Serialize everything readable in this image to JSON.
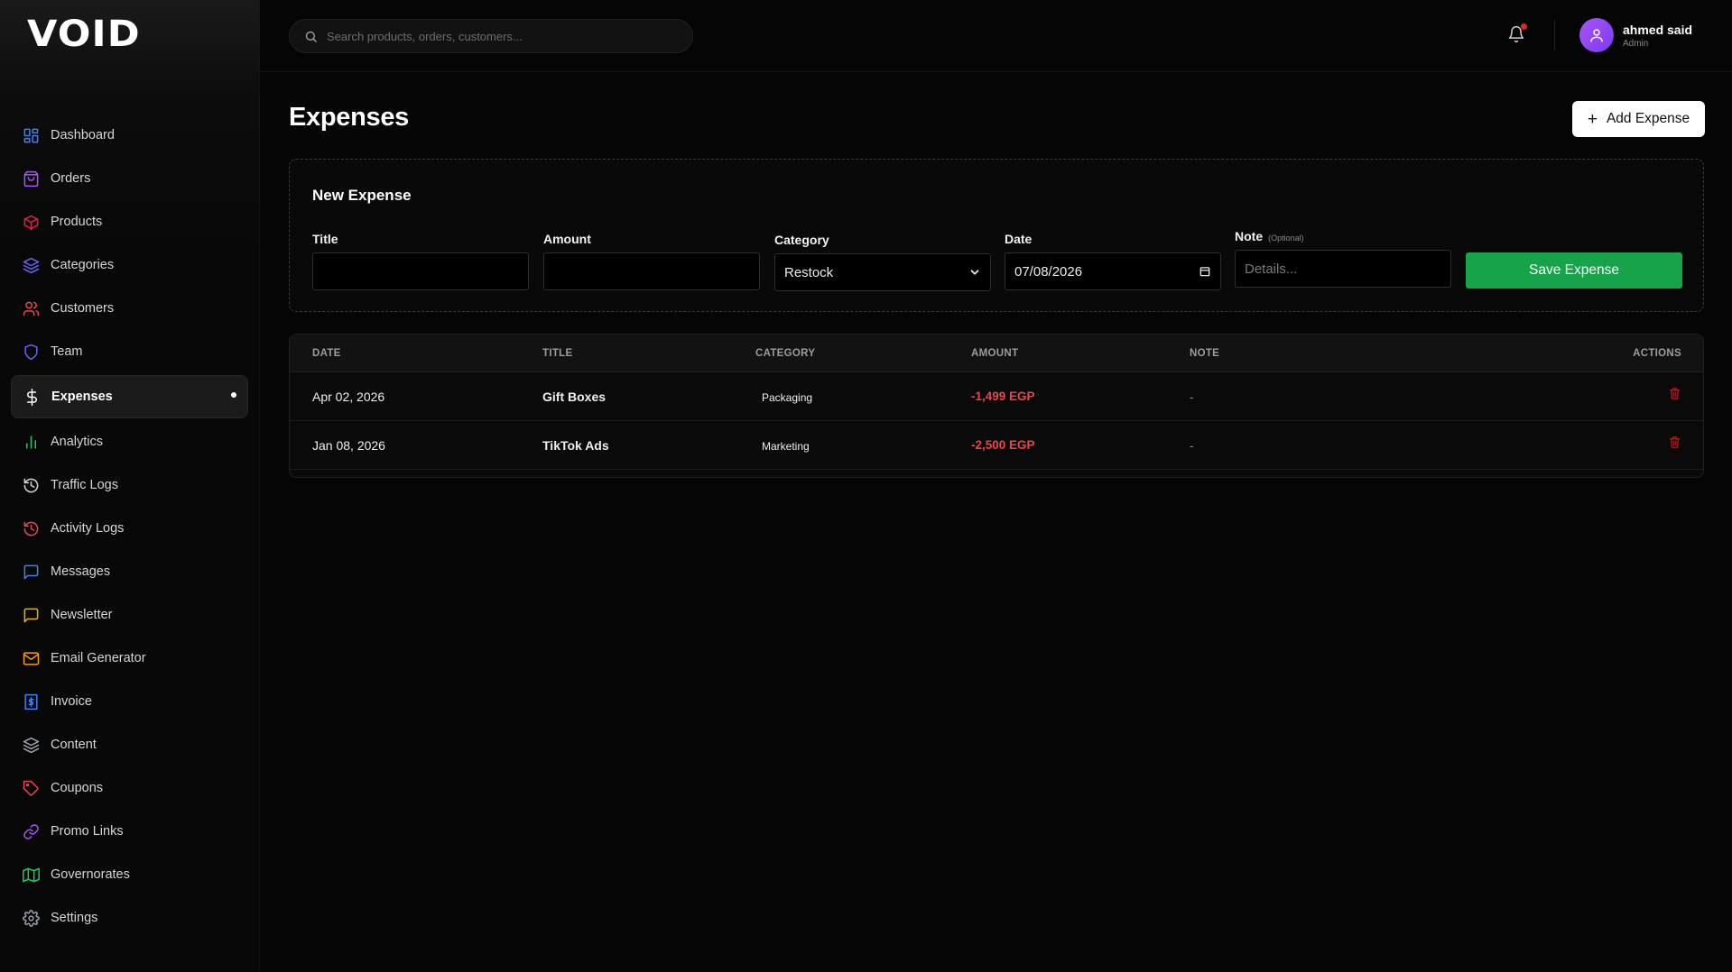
{
  "app": {
    "logo_text": "VOID"
  },
  "sidebar": {
    "items": [
      {
        "label": "Dashboard",
        "icon": "dashboard-icon",
        "color": "#3b82f6"
      },
      {
        "label": "Orders",
        "icon": "shopping-bag-icon",
        "color": "#a855f7"
      },
      {
        "label": "Products",
        "icon": "package-icon",
        "color": "#e11d48"
      },
      {
        "label": "Categories",
        "icon": "layers-icon",
        "color": "#6366f1"
      },
      {
        "label": "Customers",
        "icon": "users-icon",
        "color": "#ef4444"
      },
      {
        "label": "Team",
        "icon": "shield-icon",
        "color": "#6366f1"
      },
      {
        "label": "Expenses",
        "icon": "dollar-icon",
        "color": "#ffffff",
        "active": true
      },
      {
        "label": "Analytics",
        "icon": "bar-chart-icon",
        "color": "#22c55e"
      },
      {
        "label": "Traffic Logs",
        "icon": "history-icon",
        "color": "#d1d5db"
      },
      {
        "label": "Activity Logs",
        "icon": "history-icon",
        "color": "#ef4444"
      },
      {
        "label": "Messages",
        "icon": "message-icon",
        "color": "#3b82f6"
      },
      {
        "label": "Newsletter",
        "icon": "message-square-icon",
        "color": "#eab308"
      },
      {
        "label": "Email Generator",
        "icon": "mail-icon",
        "color": "#f59e0b"
      },
      {
        "label": "Invoice",
        "icon": "invoice-icon",
        "color": "#3b82f6"
      },
      {
        "label": "Content",
        "icon": "layers-icon",
        "color": "#9ca3af"
      },
      {
        "label": "Coupons",
        "icon": "tag-icon",
        "color": "#ef4444"
      },
      {
        "label": "Promo Links",
        "icon": "link-icon",
        "color": "#a855f7"
      },
      {
        "label": "Governorates",
        "icon": "map-icon",
        "color": "#22c55e"
      },
      {
        "label": "Settings",
        "icon": "gear-icon",
        "color": "#9ca3af"
      }
    ]
  },
  "topbar": {
    "search_placeholder": "Search products, orders, customers...",
    "user": {
      "name": "ahmed said",
      "role": "Admin"
    }
  },
  "page": {
    "title": "Expenses",
    "add_button": "Add Expense"
  },
  "form": {
    "title": "New Expense",
    "fields": {
      "title_label": "Title",
      "title_value": "",
      "amount_label": "Amount",
      "amount_value": "",
      "category_label": "Category",
      "category_value": "Restock",
      "date_label": "Date",
      "date_value": "07/08/2026",
      "note_label": "Note",
      "note_optional": "(Optional)",
      "note_placeholder": "Details..."
    },
    "save_button": "Save Expense"
  },
  "table": {
    "headers": [
      "DATE",
      "TITLE",
      "CATEGORY",
      "AMOUNT",
      "NOTE",
      "ACTIONS"
    ],
    "rows": [
      {
        "date": "Apr 02, 2026",
        "title": "Gift Boxes",
        "category": "Packaging",
        "amount": "-1,499 EGP",
        "note": "-"
      },
      {
        "date": "Jan 08, 2026",
        "title": "TikTok Ads",
        "category": "Marketing",
        "amount": "-2,500 EGP",
        "note": "-"
      }
    ]
  },
  "colors": {
    "accent_green": "#16a34a",
    "amount_red": "#ef4444",
    "notification_red": "#e5252a",
    "avatar_purple": "#a855f7"
  }
}
